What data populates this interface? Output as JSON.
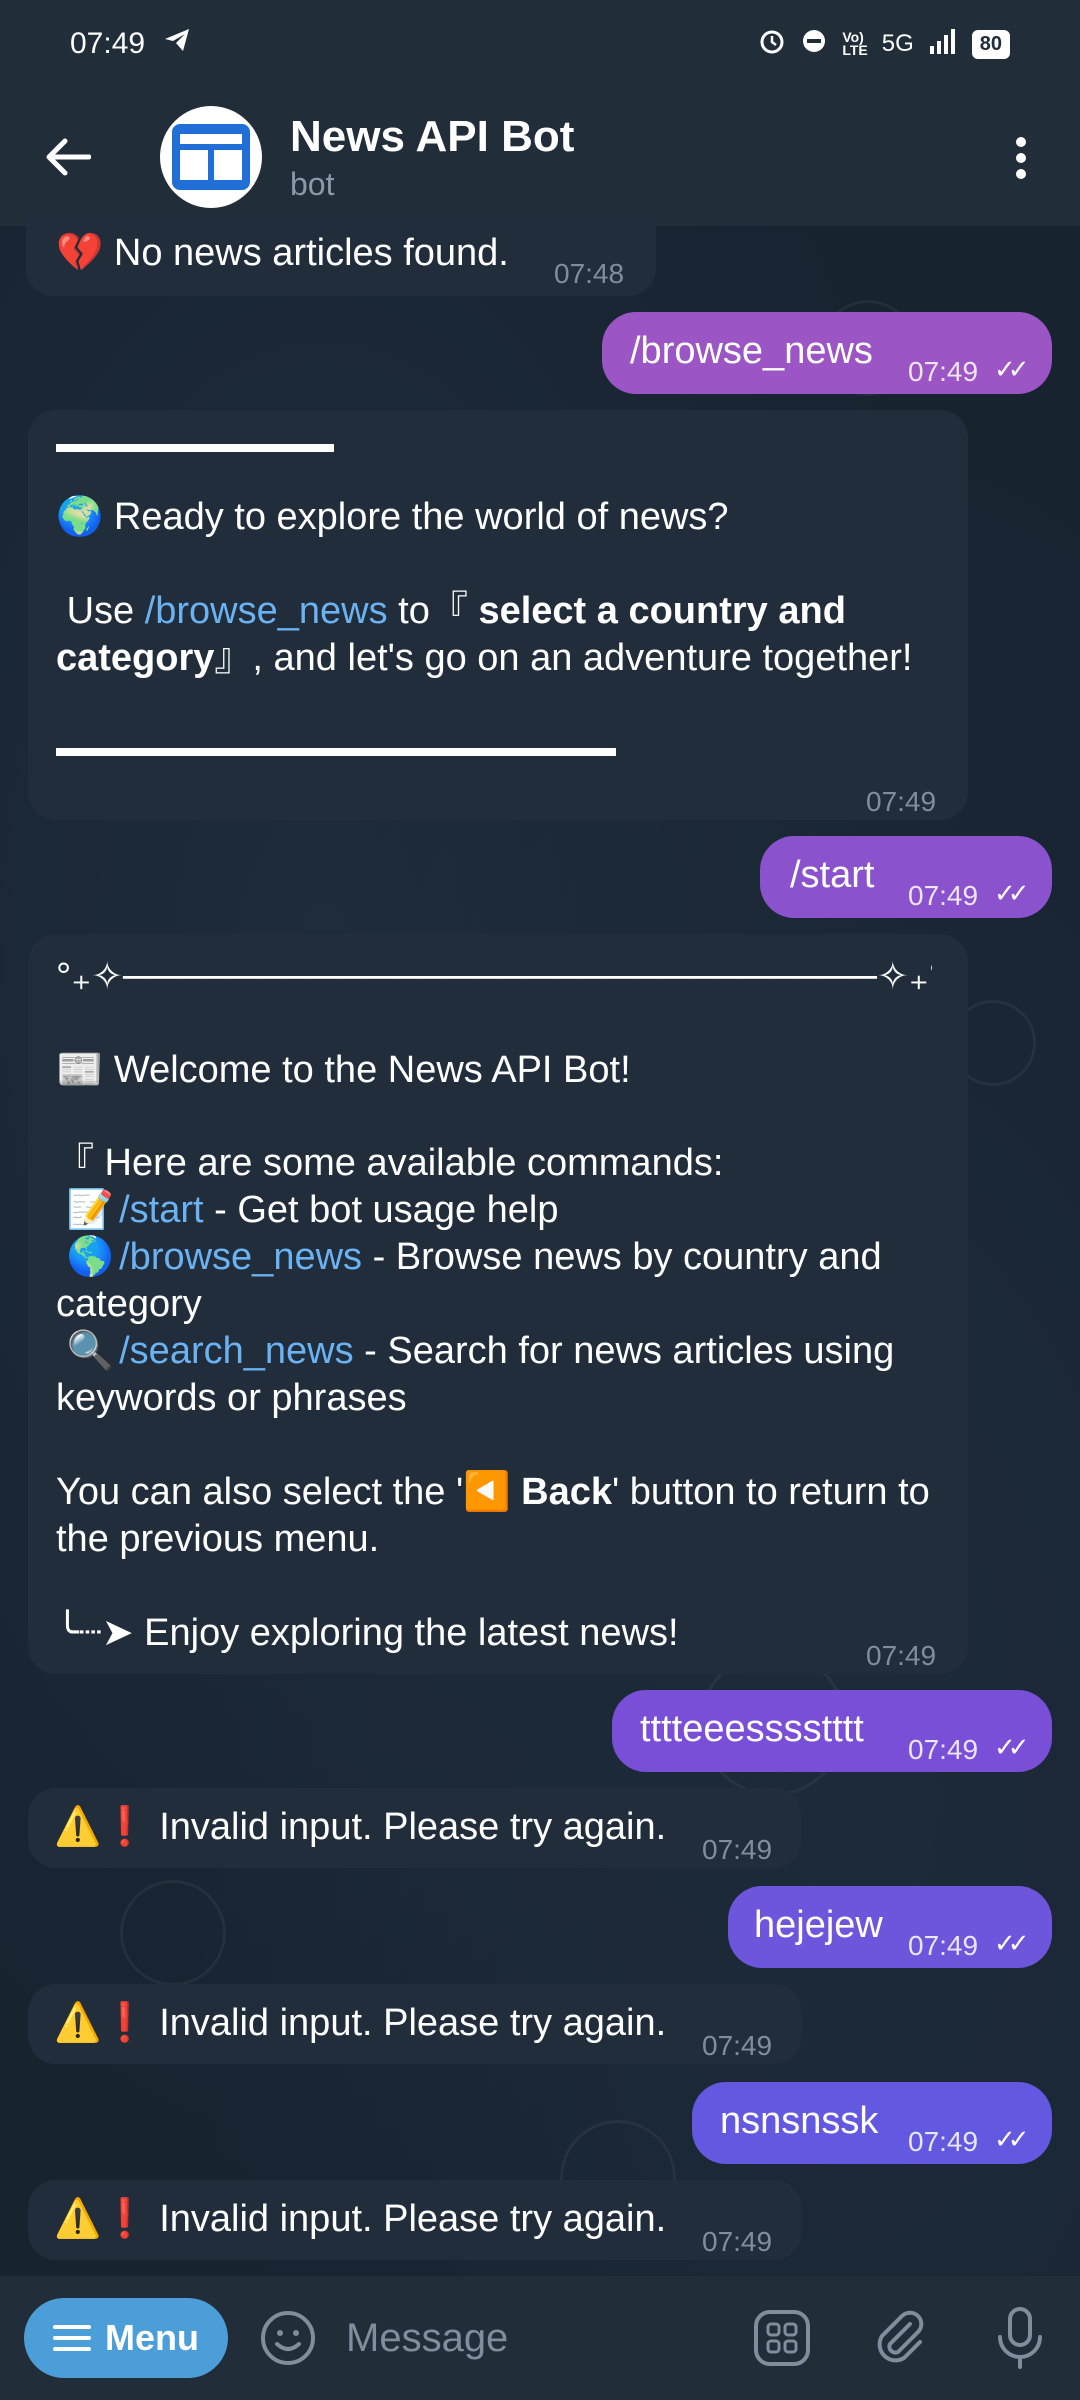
{
  "status_bar": {
    "time": "07:49",
    "network": "5G",
    "battery": "80"
  },
  "header": {
    "title": "News API Bot",
    "subtitle": "bot"
  },
  "messages": {
    "m0": {
      "icon": "💔",
      "text": "No news articles found.",
      "time": "07:48"
    },
    "m1": {
      "text": "/browse_news",
      "time": "07:49"
    },
    "m2": {
      "line1_icon": "🌍",
      "line1": "Ready to explore the world of news?",
      "use": "Use",
      "cmd": "/browse_news",
      "to": "to",
      "open": "『",
      "bold": "select a country and category",
      "close": "』",
      "rest": ", and let's go on an adventure together!",
      "time": "07:49"
    },
    "m3": {
      "text": "/start",
      "time": "07:49"
    },
    "m4": {
      "top_decor": "°₊✧────────────────────────────✧₊°",
      "welcome_icon": "📰",
      "welcome": "Welcome to the News API Bot!",
      "commands_intro": "『 Here are some available commands:",
      "c1_icon": "📝",
      "c1_cmd": "/start",
      "c1_desc": " - Get bot usage help",
      "c2_icon": "🌎",
      "c2_cmd": "/browse_news",
      "c2_desc": " - Browse news by country and category",
      "c3_icon": "🔍",
      "c3_cmd": "/search_news",
      "c3_desc": " - Search for news articles using keywords or phrases",
      "back_pre": "You can also select the '",
      "back_icon": "◀️",
      "back_bold": "Back",
      "back_post": "' button to return to the previous menu.",
      "footer": "╰┈➤ Enjoy exploring the latest news!",
      "time": "07:49"
    },
    "m5": {
      "text": "tttteeesssstttt",
      "time": "07:49"
    },
    "m6": {
      "icon": "⚠️❗",
      "text": "Invalid input. Please try again.",
      "time": "07:49"
    },
    "m7": {
      "text": "hejejew",
      "time": "07:49"
    },
    "m8": {
      "icon": "⚠️❗",
      "text": "Invalid input. Please try again.",
      "time": "07:49"
    },
    "m9": {
      "text": "nsnsnssk",
      "time": "07:49"
    },
    "m10": {
      "icon": "⚠️❗",
      "text": "Invalid input. Please try again.",
      "time": "07:49"
    }
  },
  "input_bar": {
    "menu_label": "Menu",
    "placeholder": "Message"
  },
  "colors": {
    "bubble_in": "#212d3b",
    "accent": "#4b9ed8",
    "link": "#6ab2f2"
  }
}
